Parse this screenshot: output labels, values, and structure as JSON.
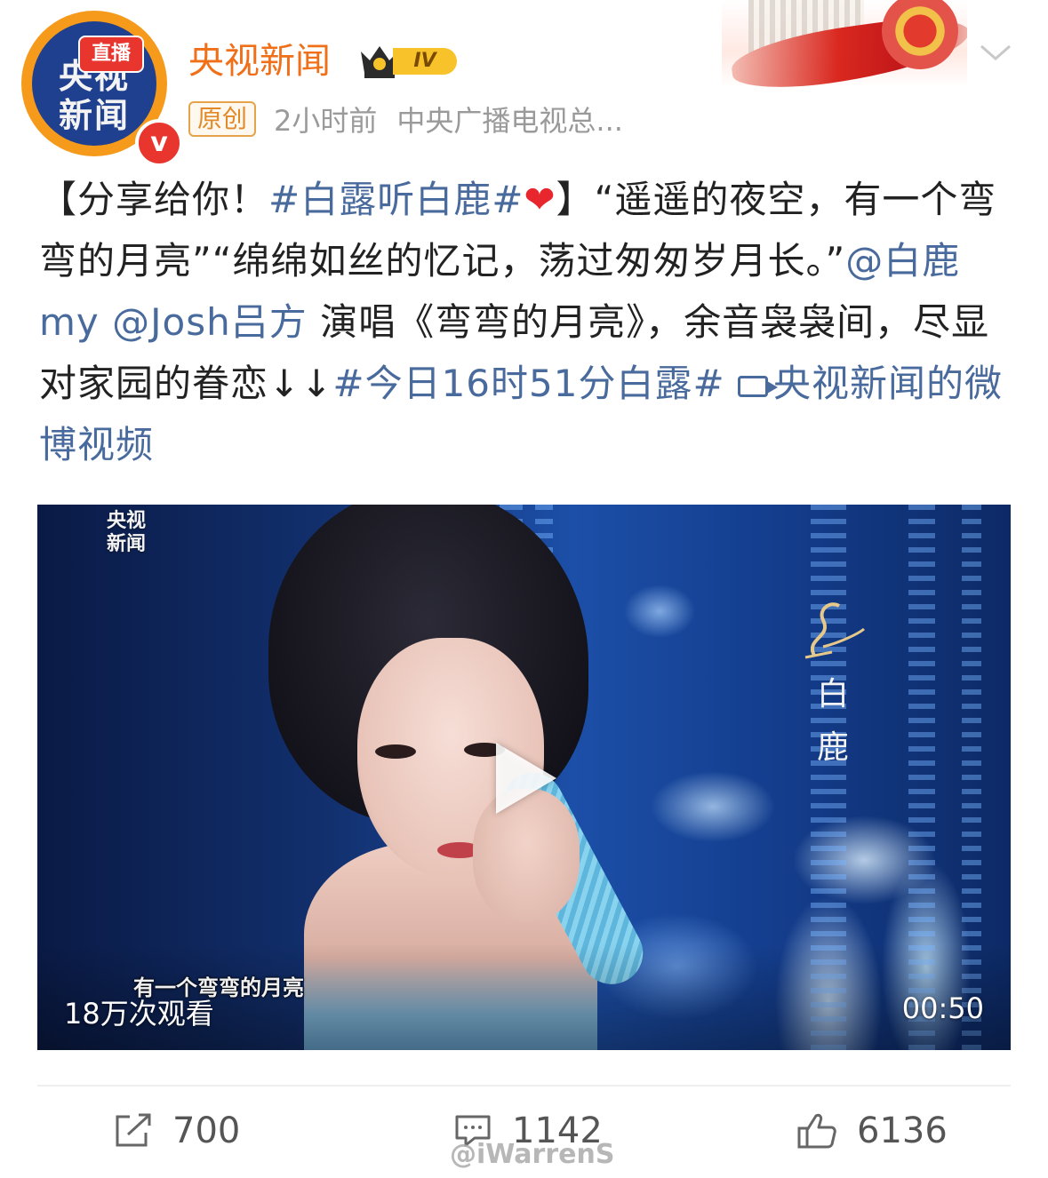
{
  "header": {
    "account_name": "央视新闻",
    "vip_level": "IV",
    "avatar_live_label": "直播",
    "avatar_logo_line1": "央视",
    "avatar_logo_line2": "新闻",
    "verified_badge": "v",
    "original_tag": "原创",
    "time": "2小时前",
    "source": "中央广播电视总..."
  },
  "post": {
    "p1": "【分享给你！",
    "tag1": "#白露听白鹿#",
    "heart": "❤",
    "p2": "】“遥遥的夜空，有一个弯弯的月亮”“绵绵如丝的忆记，荡过匆匆岁月长。”",
    "mention1": "@白鹿my",
    "mention2": "@Josh吕方",
    "p3": " 演唱《弯弯的月亮》，余音袅袅间，尽显对家园的眷恋↓↓",
    "tag2": "#今日16时51分白露#",
    "video_link": "央视新闻的微博视频"
  },
  "video": {
    "corner_logo_line1": "央视",
    "corner_logo_line2": "新闻",
    "name_char1": "白",
    "name_char2": "鹿",
    "subtitle": "有一个弯弯的月亮",
    "views": "18万次观看",
    "duration": "00:50"
  },
  "actions": {
    "repost_count": "700",
    "comment_count": "1142",
    "like_count": "6136"
  },
  "watermark": "@iWarrenS",
  "icons": {
    "repost": "share-icon",
    "comment": "comment-icon",
    "like": "thumbs-up-icon",
    "play": "play-icon",
    "more": "chevron-down-icon"
  },
  "colors": {
    "name": "#f0701a",
    "link": "#496a9c",
    "original_tag": "#e08a2a"
  }
}
